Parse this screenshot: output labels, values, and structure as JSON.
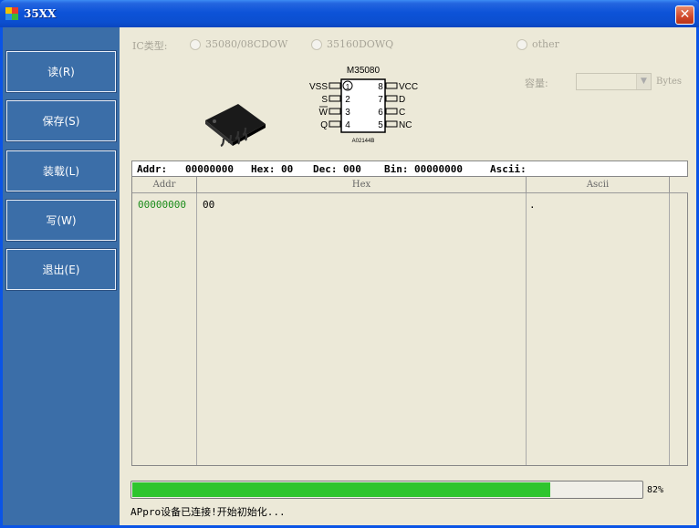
{
  "window": {
    "title": "35XX",
    "close_glyph": "✕"
  },
  "sidebar": {
    "buttons": [
      {
        "label": "读(R)"
      },
      {
        "label": "保存(S)"
      },
      {
        "label": "装载(L)"
      },
      {
        "label": "写(W)"
      },
      {
        "label": "退出(E)"
      }
    ]
  },
  "ic_type": {
    "label": "IC类型:",
    "options": [
      "35080/08CDOW",
      "35160DOWQ",
      "other"
    ]
  },
  "capacity": {
    "label": "容量:",
    "value": "",
    "unit": "Bytes"
  },
  "chip_diagram": {
    "part_name": "M35080",
    "left_pins": [
      "VSS",
      "S",
      "W",
      "Q"
    ],
    "left_numbers": [
      "1",
      "2",
      "3",
      "4"
    ],
    "right_numbers": [
      "8",
      "7",
      "6",
      "5"
    ],
    "right_pins": [
      "VCC",
      "D",
      "C",
      "NC"
    ],
    "code": "A02144B"
  },
  "info": {
    "addr_label": "Addr:",
    "addr_value": "00000000",
    "hex_label": "Hex:",
    "hex_value": "00",
    "dec_label": "Dec:",
    "dec_value": "000",
    "bin_label": "Bin:",
    "bin_value": "00000000",
    "ascii_label": "Ascii:",
    "ascii_value": ""
  },
  "grid": {
    "headers": [
      "Addr",
      "Hex",
      "Ascii"
    ],
    "rows": [
      {
        "addr": "00000000",
        "hex": "00",
        "ascii": "."
      }
    ]
  },
  "progress": {
    "percent": 82,
    "label": "82%"
  },
  "status": {
    "text": "APpro设备已连接!开始初始化..."
  },
  "colors": {
    "sidebar": "#3b6ea8",
    "progress": "#2ec52e",
    "addr_text": "#1a8c1a"
  }
}
